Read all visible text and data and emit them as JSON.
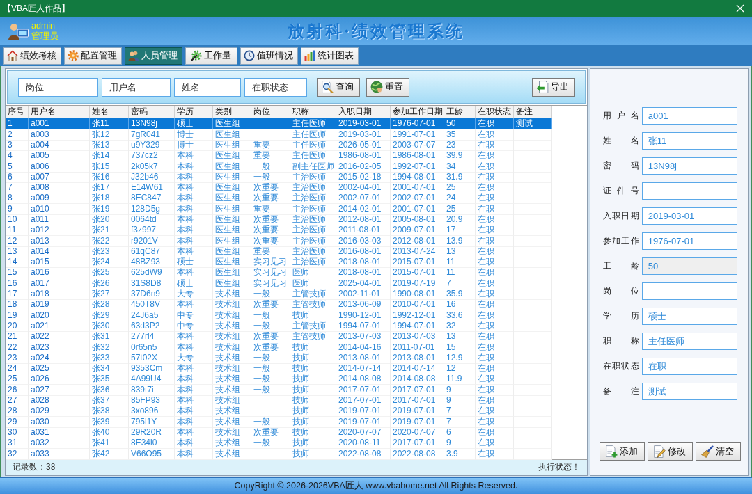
{
  "window": {
    "title": "【VBA匠人作品】"
  },
  "header": {
    "user_name": "admin",
    "user_role": "管理员",
    "app_title": "放射科·绩效管理系统"
  },
  "tabs": [
    {
      "label": "绩效考核",
      "selected": false
    },
    {
      "label": "配置管理",
      "selected": false
    },
    {
      "label": "人员管理",
      "selected": true
    },
    {
      "label": "工作量",
      "selected": false
    },
    {
      "label": "值班情况",
      "selected": false
    },
    {
      "label": "统计图表",
      "selected": false
    }
  ],
  "search": {
    "fields": [
      {
        "placeholder": "岗位"
      },
      {
        "placeholder": "用户名"
      },
      {
        "placeholder": "姓名"
      },
      {
        "placeholder": "在职状态"
      }
    ],
    "buttons": [
      {
        "label": "查询"
      },
      {
        "label": "重置"
      },
      {
        "label": "导出"
      }
    ]
  },
  "table": {
    "columns": [
      "序号",
      "用户名",
      "姓名",
      "密码",
      "学历",
      "类别",
      "岗位",
      "职称",
      "入职日期",
      "参加工作日期",
      "工龄",
      "在职状态",
      "备注"
    ],
    "rows": [
      {
        "no": "1",
        "username": "a001",
        "name": "张11",
        "password": "13N98j",
        "education": "硕士",
        "category": "医生组",
        "title": "主任医师",
        "hire_date": "2019-03-01",
        "work_date": "1976-07-01",
        "seniority": "50",
        "status": "在职",
        "remark": "测试",
        "selected": true
      },
      {
        "no": "2",
        "username": "a003",
        "name": "张12",
        "password": "7gR041",
        "education": "博士",
        "category": "医生组",
        "title": "主任医师",
        "hire_date": "2019-03-01",
        "work_date": "1991-07-01",
        "seniority": "35",
        "status": "在职",
        "selected": false
      },
      {
        "no": "3",
        "username": "a004",
        "name": "张13",
        "password": "u9Y329",
        "education": "博士",
        "category": "医生组",
        "post": "重要",
        "title": "主任医师",
        "hire_date": "2026-05-01",
        "work_date": "2003-07-07",
        "seniority": "23",
        "status": "在职",
        "selected": false
      },
      {
        "no": "4",
        "username": "a005",
        "name": "张14",
        "password": "737cz2",
        "education": "本科",
        "category": "医生组",
        "post": "重要",
        "title": "主任医师",
        "hire_date": "1986-08-01",
        "work_date": "1986-08-01",
        "seniority": "39.9",
        "status": "在职",
        "selected": false
      },
      {
        "no": "5",
        "username": "a006",
        "name": "张15",
        "password": "2k05k7",
        "education": "本科",
        "category": "医生组",
        "post": "一般",
        "title": "副主任医师",
        "hire_date": "2016-02-05",
        "work_date": "1992-07-01",
        "seniority": "34",
        "status": "在职",
        "selected": false
      },
      {
        "no": "6",
        "username": "a007",
        "name": "张16",
        "password": "J32b46",
        "education": "本科",
        "category": "医生组",
        "post": "一般",
        "title": "主治医师",
        "hire_date": "2015-02-18",
        "work_date": "1994-08-01",
        "seniority": "31.9",
        "status": "在职",
        "selected": false
      },
      {
        "no": "7",
        "username": "a008",
        "name": "张17",
        "password": "E14W61",
        "education": "本科",
        "category": "医生组",
        "post": "次重要",
        "title": "主治医师",
        "hire_date": "2002-04-01",
        "work_date": "2001-07-01",
        "seniority": "25",
        "status": "在职",
        "selected": false
      },
      {
        "no": "8",
        "username": "a009",
        "name": "张18",
        "password": "8EC847",
        "education": "本科",
        "category": "医生组",
        "post": "次重要",
        "title": "主治医师",
        "hire_date": "2002-07-01",
        "work_date": "2002-07-01",
        "seniority": "24",
        "status": "在职",
        "selected": false
      },
      {
        "no": "9",
        "username": "a010",
        "name": "张19",
        "password": "128D5g",
        "education": "本科",
        "category": "医生组",
        "post": "重要",
        "title": "主治医师",
        "hire_date": "2014-02-01",
        "work_date": "2001-07-01",
        "seniority": "25",
        "status": "在职",
        "selected": false
      },
      {
        "no": "10",
        "username": "a011",
        "name": "张20",
        "password": "0064td",
        "education": "本科",
        "category": "医生组",
        "post": "次重要",
        "title": "主治医师",
        "hire_date": "2012-08-01",
        "work_date": "2005-08-01",
        "seniority": "20.9",
        "status": "在职",
        "selected": false
      },
      {
        "no": "11",
        "username": "a012",
        "name": "张21",
        "password": "f3z997",
        "education": "本科",
        "category": "医生组",
        "post": "次重要",
        "title": "主治医师",
        "hire_date": "2011-08-01",
        "work_date": "2009-07-01",
        "seniority": "17",
        "status": "在职",
        "selected": false
      },
      {
        "no": "12",
        "username": "a013",
        "name": "张22",
        "password": "r9201V",
        "education": "本科",
        "category": "医生组",
        "post": "次重要",
        "title": "主治医师",
        "hire_date": "2016-03-03",
        "work_date": "2012-08-01",
        "seniority": "13.9",
        "status": "在职",
        "selected": false
      },
      {
        "no": "13",
        "username": "a014",
        "name": "张23",
        "password": "61qC87",
        "education": "本科",
        "category": "医生组",
        "post": "重要",
        "title": "主治医师",
        "hire_date": "2016-08-01",
        "work_date": "2013-07-24",
        "seniority": "13",
        "status": "在职",
        "selected": false
      },
      {
        "no": "14",
        "username": "a015",
        "name": "张24",
        "password": "48BZ93",
        "education": "硕士",
        "category": "医生组",
        "post": "实习见习",
        "title": "主治医师",
        "hire_date": "2018-08-01",
        "work_date": "2015-07-01",
        "seniority": "11",
        "status": "在职",
        "selected": false
      },
      {
        "no": "15",
        "username": "a016",
        "name": "张25",
        "password": "625dW9",
        "education": "本科",
        "category": "医生组",
        "post": "实习见习",
        "title": "医师",
        "hire_date": "2018-08-01",
        "work_date": "2015-07-01",
        "seniority": "11",
        "status": "在职",
        "selected": false
      },
      {
        "no": "16",
        "username": "a017",
        "name": "张26",
        "password": "31S8D8",
        "education": "硕士",
        "category": "医生组",
        "post": "实习见习",
        "title": "医师",
        "hire_date": "2025-04-01",
        "work_date": "2019-07-19",
        "seniority": "7",
        "status": "在职",
        "selected": false
      },
      {
        "no": "17",
        "username": "a018",
        "name": "张27",
        "password": "37D6n9",
        "education": "大专",
        "category": "技术组",
        "post": "一般",
        "title": "主管技师",
        "hire_date": "2002-11-01",
        "work_date": "1990-08-01",
        "seniority": "35.9",
        "status": "在职",
        "selected": false
      },
      {
        "no": "18",
        "username": "a019",
        "name": "张28",
        "password": "450T8V",
        "education": "本科",
        "category": "技术组",
        "post": "次重要",
        "title": "主管技师",
        "hire_date": "2013-06-09",
        "work_date": "2010-07-01",
        "seniority": "16",
        "status": "在职",
        "selected": false
      },
      {
        "no": "19",
        "username": "a020",
        "name": "张29",
        "password": "24J6a5",
        "education": "中专",
        "category": "技术组",
        "post": "一般",
        "title": "技师",
        "hire_date": "1990-12-01",
        "work_date": "1992-12-01",
        "seniority": "33.6",
        "status": "在职",
        "selected": false
      },
      {
        "no": "20",
        "username": "a021",
        "name": "张30",
        "password": "63d3P2",
        "education": "中专",
        "category": "技术组",
        "post": "一般",
        "title": "主管技师",
        "hire_date": "1994-07-01",
        "work_date": "1994-07-01",
        "seniority": "32",
        "status": "在职",
        "selected": false
      },
      {
        "no": "21",
        "username": "a022",
        "name": "张31",
        "password": "277rl4",
        "education": "本科",
        "category": "技术组",
        "post": "次重要",
        "title": "主管技师",
        "hire_date": "2013-07-03",
        "work_date": "2013-07-03",
        "seniority": "13",
        "status": "在职",
        "selected": false
      },
      {
        "no": "22",
        "username": "a023",
        "name": "张32",
        "password": "0r65n5",
        "education": "本科",
        "category": "技术组",
        "post": "次重要",
        "title": "技师",
        "hire_date": "2014-04-16",
        "work_date": "2011-07-01",
        "seniority": "15",
        "status": "在职",
        "selected": false
      },
      {
        "no": "23",
        "username": "a024",
        "name": "张33",
        "password": "57t02X",
        "education": "大专",
        "category": "技术组",
        "post": "一般",
        "title": "技师",
        "hire_date": "2013-08-01",
        "work_date": "2013-08-01",
        "seniority": "12.9",
        "status": "在职",
        "selected": false
      },
      {
        "no": "24",
        "username": "a025",
        "name": "张34",
        "password": "9353Cm",
        "education": "本科",
        "category": "技术组",
        "post": "一般",
        "title": "技师",
        "hire_date": "2014-07-14",
        "work_date": "2014-07-14",
        "seniority": "12",
        "status": "在职",
        "selected": false
      },
      {
        "no": "25",
        "username": "a026",
        "name": "张35",
        "password": "4A99U4",
        "education": "本科",
        "category": "技术组",
        "post": "一般",
        "title": "技师",
        "hire_date": "2014-08-08",
        "work_date": "2014-08-08",
        "seniority": "11.9",
        "status": "在职",
        "selected": false
      },
      {
        "no": "26",
        "username": "a027",
        "name": "张36",
        "password": "839t7i",
        "education": "本科",
        "category": "技术组",
        "post": "一般",
        "title": "技师",
        "hire_date": "2017-07-01",
        "work_date": "2017-07-01",
        "seniority": "9",
        "status": "在职",
        "selected": false
      },
      {
        "no": "27",
        "username": "a028",
        "name": "张37",
        "password": "85FP93",
        "education": "本科",
        "category": "技术组",
        "title": "技师",
        "hire_date": "2017-07-01",
        "work_date": "2017-07-01",
        "seniority": "9",
        "status": "在职",
        "selected": false
      },
      {
        "no": "28",
        "username": "a029",
        "name": "张38",
        "password": "3xo896",
        "education": "本科",
        "category": "技术组",
        "title": "技师",
        "hire_date": "2019-07-01",
        "work_date": "2019-07-01",
        "seniority": "7",
        "status": "在职",
        "selected": false
      },
      {
        "no": "29",
        "username": "a030",
        "name": "张39",
        "password": "795l1Y",
        "education": "本科",
        "category": "技术组",
        "post": "一般",
        "title": "技师",
        "hire_date": "2019-07-01",
        "work_date": "2019-07-01",
        "seniority": "7",
        "status": "在职",
        "selected": false
      },
      {
        "no": "30",
        "username": "a031",
        "name": "张40",
        "password": "29R20R",
        "education": "本科",
        "category": "技术组",
        "post": "次重要",
        "title": "技师",
        "hire_date": "2020-07-07",
        "work_date": "2020-07-07",
        "seniority": "6",
        "status": "在职",
        "selected": false
      },
      {
        "no": "31",
        "username": "a032",
        "name": "张41",
        "password": "8E34i0",
        "education": "本科",
        "category": "技术组",
        "post": "一般",
        "title": "技师",
        "hire_date": "2020-08-11",
        "work_date": "2017-07-01",
        "seniority": "9",
        "status": "在职",
        "selected": false
      },
      {
        "no": "32",
        "username": "a033",
        "name": "张42",
        "password": "V66O95",
        "education": "本科",
        "category": "技术组",
        "title": "技师",
        "hire_date": "2022-08-08",
        "work_date": "2022-08-08",
        "seniority": "3.9",
        "status": "在职",
        "selected": false
      }
    ]
  },
  "status_bar": {
    "record_count": "记录数：38",
    "status": "执行状态！"
  },
  "form": {
    "fields": [
      {
        "label": "用户名",
        "value": "a001",
        "disabled": false
      },
      {
        "label": "姓名",
        "value": "张11",
        "disabled": false
      },
      {
        "label": "密码",
        "value": "13N98j",
        "disabled": false
      },
      {
        "label": "证件号",
        "disabled": false
      },
      {
        "label": "入职日期",
        "value": "2019-03-01",
        "disabled": false
      },
      {
        "label": "参加工作",
        "value": "1976-07-01",
        "disabled": false
      },
      {
        "label": "工龄",
        "value": "50",
        "disabled": true
      },
      {
        "label": "岗位",
        "disabled": false
      },
      {
        "label": "学历",
        "value": "硕士",
        "disabled": false
      },
      {
        "label": "职称",
        "value": "主任医师",
        "disabled": false
      },
      {
        "label": "在职状态",
        "value": "在职",
        "disabled": false
      },
      {
        "label": "备注",
        "value": "测试",
        "disabled": false
      }
    ],
    "buttons": [
      {
        "label": "添加"
      },
      {
        "label": "修改"
      },
      {
        "label": "清空"
      }
    ]
  },
  "footer": {
    "copyright": "CopyRight © 2026-2026VBA匠人 www.vbahome.net All Rights Reserved."
  }
}
